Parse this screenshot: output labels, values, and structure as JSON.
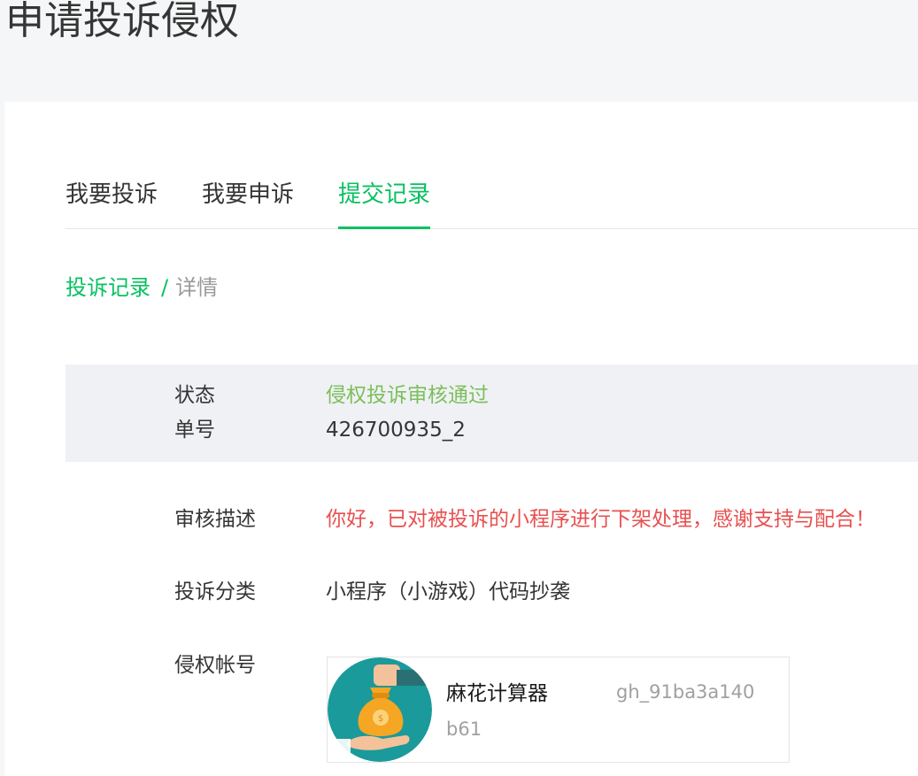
{
  "page": {
    "title": "申请投诉侵权"
  },
  "tabs": [
    {
      "label": "我要投诉",
      "active": false
    },
    {
      "label": "我要申诉",
      "active": false
    },
    {
      "label": "提交记录",
      "active": true
    }
  ],
  "breadcrumb": {
    "parent": "投诉记录",
    "separator": "/",
    "current": "详情"
  },
  "details": {
    "status_label": "状态",
    "status_value": "侵权投诉审核通过",
    "order_label": "单号",
    "order_value": "426700935_2",
    "review_label": "审核描述",
    "review_value": "你好，已对被投诉的小程序进行下架处理，感谢支持与配合！",
    "category_label": "投诉分类",
    "category_value": "小程序（小游戏）代码抄袭",
    "account_label": "侵权帐号"
  },
  "account": {
    "name": "麻花计算器",
    "id_part1": "gh_91ba3a140",
    "id_part2": "b61",
    "avatar_icon": "money-bag-hand-icon"
  },
  "colors": {
    "accent": "#07c160",
    "status_green": "#7bbf5a",
    "review_red": "#e85050",
    "avatar_teal": "#1a9a9a",
    "avatar_orange": "#f5a623"
  }
}
